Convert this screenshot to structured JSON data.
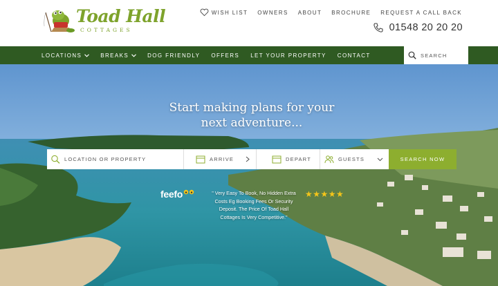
{
  "brand": {
    "name": "Toad Hall",
    "sub": "COTTAGES",
    "accent": "#7ea32c",
    "nav_bg": "#2f5a22",
    "cta_bg": "#8dae2f"
  },
  "toplinks": [
    {
      "label": "WISH LIST",
      "icon": "heart-icon"
    },
    {
      "label": "OWNERS"
    },
    {
      "label": "ABOUT"
    },
    {
      "label": "BROCHURE"
    },
    {
      "label": "REQUEST A CALL BACK"
    }
  ],
  "phone": {
    "number": "01548 20 20 20",
    "icon": "phone-icon"
  },
  "nav": {
    "items": [
      {
        "label": "LOCATIONS",
        "dropdown": true
      },
      {
        "label": "BREAKS",
        "dropdown": true
      },
      {
        "label": "DOG FRIENDLY"
      },
      {
        "label": "OFFERS"
      },
      {
        "label": "LET YOUR PROPERTY"
      },
      {
        "label": "CONTACT"
      }
    ],
    "search_label": "SEARCH"
  },
  "hero": {
    "line1": "Start making plans for your",
    "line2": "next adventure..."
  },
  "search": {
    "location_placeholder": "LOCATION OR PROPERTY",
    "arrive_label": "ARRIVE",
    "depart_label": "DEPART",
    "guests_label": "GUESTS",
    "button_label": "SEARCH NOW"
  },
  "feefo": {
    "brand": "feefo",
    "review": "\" Very Easy To Book, No Hidden Extra Costs Eg Booking Fees Or Security Deposit. The Price Of Toad Hall Cottages Is Very Competitive.\"",
    "stars": "★★★★★",
    "rating": 5
  }
}
